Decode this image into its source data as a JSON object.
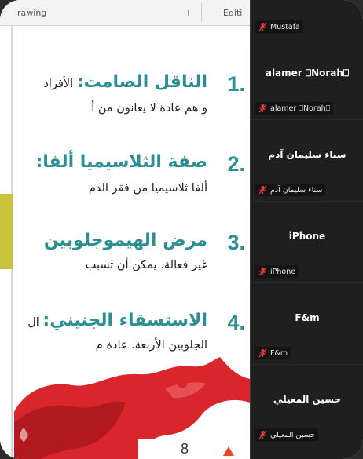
{
  "ribbon": {
    "drawing_label": "rawing",
    "editing_label": "Editi"
  },
  "slide": {
    "items": [
      {
        "num": "1.",
        "heading": "الناقل الصامت:",
        "heading_tail": " الأفراد",
        "body": "و هم عادة لا يعانون من أ"
      },
      {
        "num": "2.",
        "heading": "صفة الثلاسيميا ألفا:",
        "heading_tail": "",
        "body": "ألفا ثلاسيميا من فقر الدم"
      },
      {
        "num": "3.",
        "heading": "مرض الهيموجلوبين",
        "heading_tail": "",
        "body": "غير فعالة. يمكن أن تسبب"
      },
      {
        "num": "4.",
        "heading": "الاستسقاء الجنيني:",
        "heading_tail": " ال",
        "body": "الجلوبين الأربعة. عادة م"
      }
    ],
    "page_number": "8",
    "accent_color": "#2b8f93",
    "blood_color": "#d8262c"
  },
  "participants": [
    {
      "display": "",
      "tag": "Mustafa"
    },
    {
      "display": "alamer ⎕Norah⎕",
      "tag": "alamer ⎕Norah⎕"
    },
    {
      "display": "سناء سليمان آدم",
      "tag": "سناء سليمان آدم"
    },
    {
      "display": "iPhone",
      "tag": "iPhone"
    },
    {
      "display": "F&m",
      "tag": "F&m"
    },
    {
      "display": "حسين المعيلي",
      "tag": "حسين المعيلي"
    }
  ],
  "icons": {
    "muted": "mic-muted-icon"
  }
}
